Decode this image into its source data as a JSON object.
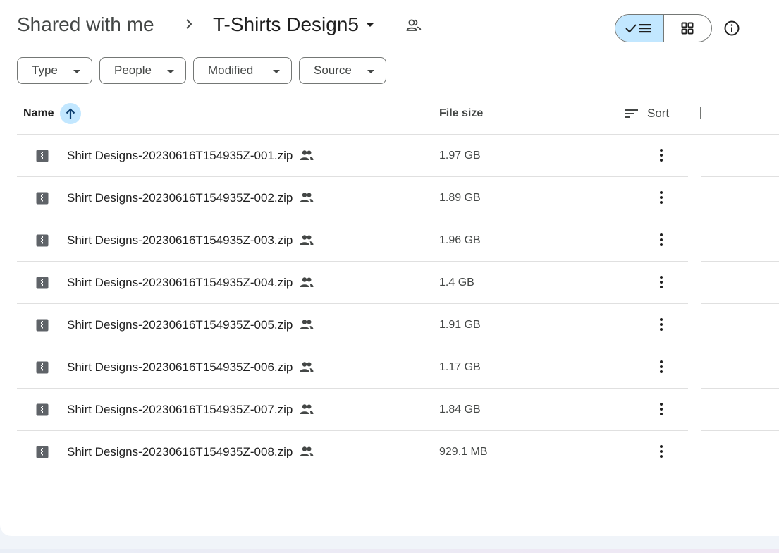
{
  "breadcrumb": {
    "root": "Shared with me",
    "current": "T-Shirts Design5"
  },
  "view_toggle": {
    "selected": "list",
    "icons": [
      "check-icon",
      "list-icon",
      "grid-icon"
    ]
  },
  "filters": [
    {
      "label": "Type"
    },
    {
      "label": "People"
    },
    {
      "label": "Modified"
    },
    {
      "label": "Source"
    }
  ],
  "table": {
    "columns": {
      "name": "Name",
      "size": "File size",
      "sort": "Sort"
    },
    "sort_direction": "ascending",
    "rows": [
      {
        "name": "Shirt Designs-20230616T154935Z-001.zip",
        "size": "1.97 GB"
      },
      {
        "name": "Shirt Designs-20230616T154935Z-002.zip",
        "size": "1.89 GB"
      },
      {
        "name": "Shirt Designs-20230616T154935Z-003.zip",
        "size": "1.96 GB"
      },
      {
        "name": "Shirt Designs-20230616T154935Z-004.zip",
        "size": "1.4 GB"
      },
      {
        "name": "Shirt Designs-20230616T154935Z-005.zip",
        "size": "1.91 GB"
      },
      {
        "name": "Shirt Designs-20230616T154935Z-006.zip",
        "size": "1.17 GB"
      },
      {
        "name": "Shirt Designs-20230616T154935Z-007.zip",
        "size": "1.84 GB"
      },
      {
        "name": "Shirt Designs-20230616T154935Z-008.zip",
        "size": "929.1 MB"
      }
    ]
  },
  "colors": {
    "accent": "#c2e7ff",
    "text": "#1f1f1f",
    "muted": "#444746",
    "divider": "#e0e0e0"
  }
}
